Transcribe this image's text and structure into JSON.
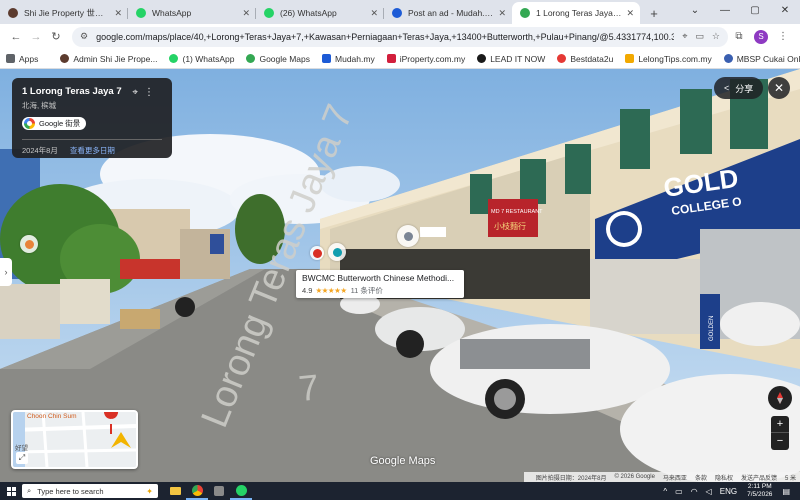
{
  "browser": {
    "tabs": [
      {
        "label": "Shi Jie Property 世界地产",
        "favicon_color": "#5c3b2e",
        "active": false
      },
      {
        "label": "WhatsApp",
        "favicon_color": "#25d366",
        "active": false
      },
      {
        "label": "(26) WhatsApp",
        "favicon_color": "#25d366",
        "active": false
      },
      {
        "label": "Post an ad - Mudah.my",
        "favicon_color": "#1d5bd6",
        "active": false
      },
      {
        "label": "1 Lorong Teras Jaya 7 - Goog",
        "favicon_color": "#34a853",
        "active": true
      }
    ],
    "new_tab_glyph": "+",
    "window_controls": {
      "tabsearch": "⌄",
      "minimize": "—",
      "maximize": "▢",
      "close": "✕"
    },
    "url": "google.com/maps/place/40,+Lorong+Teras+Jaya+7,+Kawasan+Perniagaan+Teras+Jaya,+13400+Butterworth,+Pulau+Pinang/@5.4331774,100.3902205,3a,75...",
    "profile_initial": "S",
    "bookmarks": [
      {
        "label": "Apps",
        "icon_color": "#5f6368"
      },
      {
        "label": "Admin Shi Jie Prope...",
        "icon_color": "#5c3b2e"
      },
      {
        "label": "(1) WhatsApp",
        "icon_color": "#25d366"
      },
      {
        "label": "Google Maps",
        "icon_color": "#34a853"
      },
      {
        "label": "Mudah.my",
        "icon_color": "#1d5bd6"
      },
      {
        "label": "iProperty.com.my",
        "icon_color": "#d21f3c"
      },
      {
        "label": "LEAD IT NOW",
        "icon_color": "#1a1a1a"
      },
      {
        "label": "Bestdata2u",
        "icon_color": "#e53935"
      },
      {
        "label": "LelongTips.com.my",
        "icon_color": "#f2a900"
      },
      {
        "label": "MBSP Cukai Online",
        "icon_color": "#3a5fb0"
      }
    ],
    "bookmarks_more": "»"
  },
  "streetview": {
    "info_card": {
      "title": "1 Lorong Teras Jaya 7",
      "subtitle": "北海, 槟城",
      "brand": "Google 街景",
      "date": "2024年8月",
      "more_dates_link": "查看更多日期"
    },
    "share_label": "分享",
    "close_glyph": "✕",
    "side_handle_glyph": "›",
    "place_card": {
      "name": "BWCMC Butterworth Chinese Methodi...",
      "rating": "4.9",
      "stars": "★★★★★",
      "reviews": "11 条评价"
    },
    "road_text": "Lorong Teras Jaya 7",
    "signs": {
      "restaurant": "MD 7 RESTAURANT",
      "restaurant_cn": "小枝麵行",
      "college_main": "GOLD",
      "college_sub": "COLLEGE O",
      "college_vertical": "GOLDEN"
    },
    "minimap": {
      "label": "Choon Chin Sum",
      "label2": "好望"
    },
    "watermark": "Google Maps",
    "zoom_in": "+",
    "zoom_out": "−",
    "attribution": [
      "图片拍摄日期：2024年8月",
      "© 2026 Google",
      "马来西亚",
      "条款",
      "隐私权",
      "发送产品反馈",
      "5 米"
    ]
  },
  "taskbar": {
    "search_placeholder": "Type here to search",
    "lang": "ENG",
    "time": "2:11 PM",
    "date": "7/5/2026"
  }
}
